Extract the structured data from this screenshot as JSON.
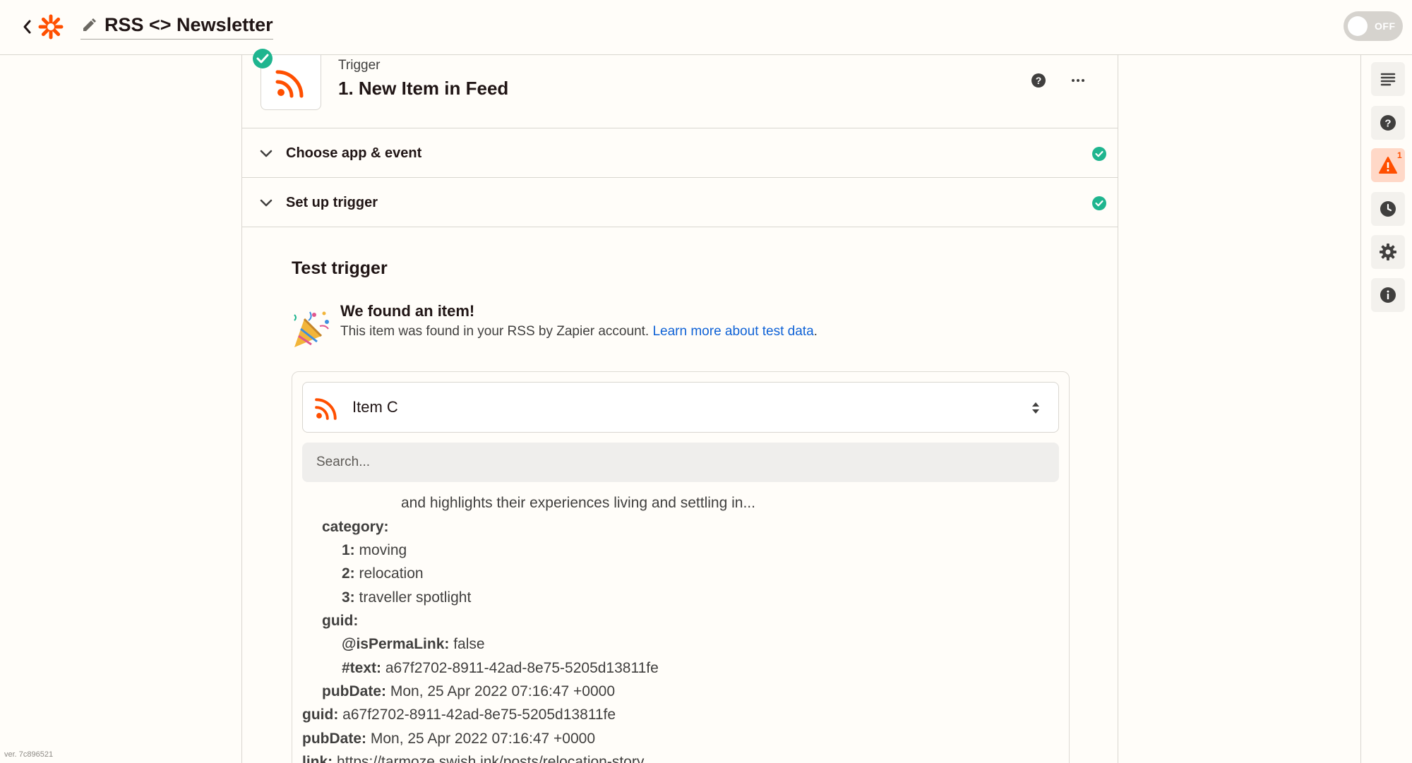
{
  "header": {
    "zap_title": "RSS <> Newsletter",
    "toggle_label": "OFF"
  },
  "step": {
    "kind": "Trigger",
    "name": "1. New Item in Feed"
  },
  "sections": [
    {
      "label": "Choose app & event"
    },
    {
      "label": "Set up trigger"
    }
  ],
  "test": {
    "title": "Test trigger",
    "found_title": "We found an item!",
    "found_desc": "This item was found in your RSS by Zapier account.",
    "learn_more": "Learn more about test data",
    "period": "."
  },
  "item_select": {
    "value": "Item C"
  },
  "search": {
    "placeholder": "Search..."
  },
  "data_rows": {
    "description_tail": "and highlights their experiences living and settling in...",
    "category_key": "category:",
    "cat1_key": "1:",
    "cat1_val": "moving",
    "cat2_key": "2:",
    "cat2_val": "relocation",
    "cat3_key": "3:",
    "cat3_val": "traveller spotlight",
    "guid_key": "guid:",
    "isperma_key": "@isPermaLink:",
    "isperma_val": "false",
    "text_key": "#text:",
    "text_val": "a67f2702-8911-42ad-8e75-5205d13811fe",
    "pubdate_key": "pubDate:",
    "pubdate_val": "Mon, 25 Apr 2022 07:16:47 +0000",
    "guid2_key": "guid:",
    "guid2_val": "a67f2702-8911-42ad-8e75-5205d13811fe",
    "pubdate2_key": "pubDate:",
    "pubdate2_val": "Mon, 25 Apr 2022 07:16:47 +0000",
    "link_key": "link:",
    "link_val": "https://tarmoze.swish.ink/posts/relocation-story"
  },
  "version": "ver. 7c896521",
  "sidebar": {
    "alert_count": "1"
  },
  "colors": {
    "brand_orange": "#ff4f00",
    "success_green": "#1fb58f",
    "link_blue": "#0f62d6"
  },
  "icons": {
    "back": "chevron-left-icon",
    "logo": "zapier-logo",
    "edit": "pencil-icon",
    "rss": "rss-icon",
    "check": "check-circle-icon",
    "help": "question-circle-icon",
    "more": "ellipsis-icon",
    "chevron": "chevron-down-icon",
    "party": "party-popper-icon",
    "sort": "sort-arrows-icon",
    "outline": "outline-list-icon",
    "alert": "warning-triangle-icon",
    "history": "clock-icon",
    "settings": "gear-icon",
    "info": "info-icon"
  }
}
